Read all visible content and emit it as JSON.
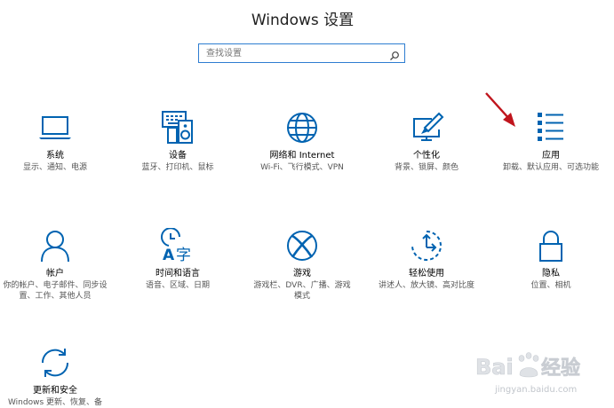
{
  "window": {
    "title": "Windows 设置"
  },
  "search": {
    "placeholder": "查找设置",
    "icon": "search-icon"
  },
  "tiles": [
    {
      "id": "system",
      "name": "系统",
      "desc": "显示、通知、电源",
      "icon": "laptop-icon"
    },
    {
      "id": "devices",
      "name": "设备",
      "desc": "蓝牙、打印机、鼠标",
      "icon": "devices-icon"
    },
    {
      "id": "network",
      "name": "网络和 Internet",
      "desc": "Wi-Fi、飞行模式、VPN",
      "icon": "globe-icon"
    },
    {
      "id": "personalization",
      "name": "个性化",
      "desc": "背景、锁屏、颜色",
      "icon": "personalization-icon"
    },
    {
      "id": "apps",
      "name": "应用",
      "desc": "卸载、默认应用、可选功能",
      "icon": "apps-list-icon"
    },
    {
      "id": "accounts",
      "name": "帐户",
      "desc": "你的帐户、电子邮件、同步设置、工作、其他人员",
      "icon": "person-icon"
    },
    {
      "id": "time-language",
      "name": "时间和语言",
      "desc": "语音、区域、日期",
      "icon": "time-language-icon"
    },
    {
      "id": "gaming",
      "name": "游戏",
      "desc": "游戏栏、DVR、广播、游戏模式",
      "icon": "xbox-icon"
    },
    {
      "id": "ease-of-access",
      "name": "轻松使用",
      "desc": "讲述人、放大镜、高对比度",
      "icon": "ease-of-access-icon"
    },
    {
      "id": "privacy",
      "name": "隐私",
      "desc": "位置、相机",
      "icon": "lock-icon"
    },
    {
      "id": "update-security",
      "name": "更新和安全",
      "desc": "Windows 更新、恢复、备",
      "icon": "sync-icon"
    }
  ],
  "annotation": {
    "arrow_color": "#c0151d",
    "target": "apps"
  },
  "watermark": {
    "brand": "Baidu 经验",
    "url": "jingyan.baidu.com"
  },
  "colors": {
    "accent": "#0063b1",
    "search_border": "#2e7dd1",
    "desc_text": "#555555"
  }
}
